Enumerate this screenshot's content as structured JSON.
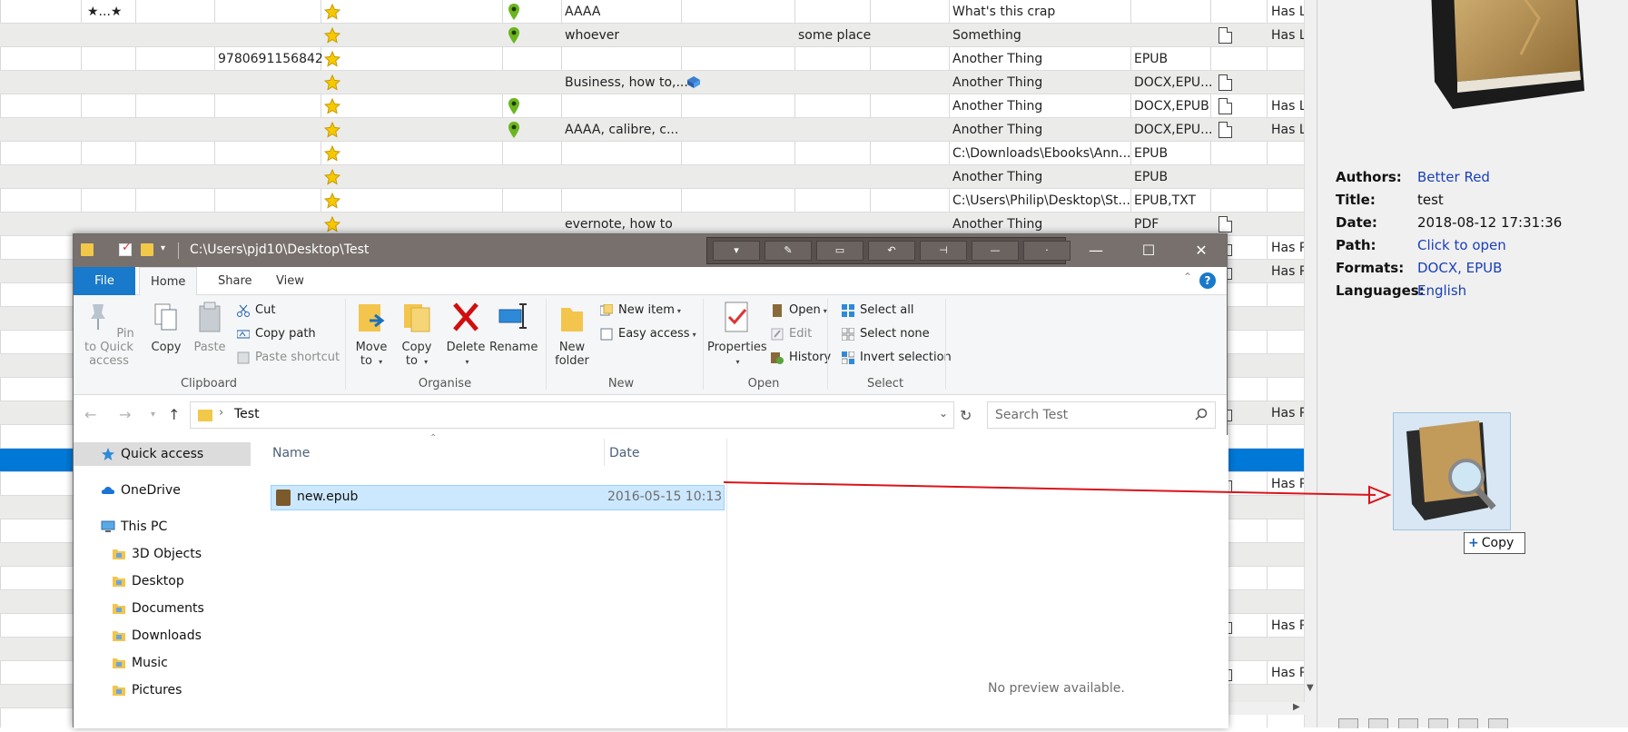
{
  "library": {
    "rows": [
      {
        "rating_text": "★...★",
        "isbn": "",
        "pin": true,
        "tags": "AAAA",
        "book_icon": false,
        "location": "",
        "publisher": "What's this crap",
        "formats": "",
        "doc": false,
        "note": "Has Le"
      },
      {
        "rating_text": "",
        "isbn": "",
        "pin": true,
        "tags": "whoever",
        "book_icon": false,
        "location": "some place",
        "publisher": "Something",
        "formats": "",
        "doc": true,
        "note": "Has Le"
      },
      {
        "rating_text": "",
        "isbn": "9780691156842",
        "pin": false,
        "tags": "",
        "book_icon": false,
        "location": "",
        "publisher": "Another Thing",
        "formats": "EPUB",
        "doc": false,
        "note": ""
      },
      {
        "rating_text": "",
        "isbn": "",
        "pin": false,
        "tags": "Business, how to,...",
        "book_icon": true,
        "location": "",
        "publisher": "Another Thing",
        "formats": "DOCX,EPU...",
        "doc": true,
        "note": ""
      },
      {
        "rating_text": "",
        "isbn": "",
        "pin": true,
        "tags": "",
        "book_icon": false,
        "location": "",
        "publisher": "Another Thing",
        "formats": "DOCX,EPUB",
        "doc": true,
        "note": "Has Le"
      },
      {
        "rating_text": "",
        "isbn": "",
        "pin": true,
        "tags": "AAAA, calibre, c...",
        "book_icon": false,
        "location": "",
        "publisher": "Another Thing",
        "formats": "DOCX,EPU...",
        "doc": true,
        "note": "Has Le"
      },
      {
        "rating_text": "",
        "isbn": "",
        "pin": false,
        "tags": "",
        "book_icon": false,
        "location": "",
        "publisher": "C:\\Downloads\\Ebooks\\Ann...",
        "formats": "EPUB",
        "doc": false,
        "note": ""
      },
      {
        "rating_text": "",
        "isbn": "",
        "pin": false,
        "tags": "",
        "book_icon": false,
        "location": "",
        "publisher": "Another Thing",
        "formats": "EPUB",
        "doc": false,
        "note": ""
      },
      {
        "rating_text": "",
        "isbn": "",
        "pin": false,
        "tags": "",
        "book_icon": false,
        "location": "",
        "publisher": "C:\\Users\\Philip\\Desktop\\St...",
        "formats": "EPUB,TXT",
        "doc": false,
        "note": ""
      },
      {
        "rating_text": "",
        "isbn": "",
        "pin": false,
        "tags": "evernote, how to",
        "book_icon": false,
        "location": "",
        "publisher": "Another Thing",
        "formats": "PDF",
        "doc": true,
        "note": ""
      }
    ],
    "right_notes": [
      {
        "row": 10,
        "note": "Has P"
      },
      {
        "row": 11,
        "note": "Has P"
      },
      {
        "row": 17,
        "note": "Has P"
      },
      {
        "row": 20,
        "note": "Has P"
      },
      {
        "row": 26,
        "note": "Has P"
      },
      {
        "row": 28,
        "note": "Has P"
      }
    ],
    "selected_row": 19
  },
  "details": {
    "fields": [
      {
        "label": "Authors:",
        "value": "Better Red",
        "link": true
      },
      {
        "label": "Title:",
        "value": "test",
        "link": false
      },
      {
        "label": "Date:",
        "value": "2018-08-12 17:31:36",
        "link": false
      },
      {
        "label": "Path:",
        "value": "Click to open",
        "link": true
      },
      {
        "label": "Formats:",
        "value": "DOCX, EPUB",
        "link": true
      },
      {
        "label": "Languages:",
        "value": "English",
        "link": true
      }
    ],
    "copy_badge": {
      "plus": "+",
      "label": "Copy"
    }
  },
  "explorer": {
    "title": "C:\\Users\\pjd10\\Desktop\\Test",
    "window_buttons": {
      "minimize": "—",
      "maximize": "☐",
      "close": "✕"
    },
    "tabs": [
      {
        "label": "File"
      },
      {
        "label": "Home"
      },
      {
        "label": "Share"
      },
      {
        "label": "View"
      }
    ],
    "help": "?",
    "ribbon": {
      "clipboard": {
        "group_label": "Clipboard",
        "pin": "Pin to Quick access",
        "copy": "Copy",
        "paste": "Paste",
        "cut": "Cut",
        "copy_path": "Copy path",
        "paste_shortcut": "Paste shortcut"
      },
      "organise": {
        "group_label": "Organise",
        "move_to": "Move to",
        "copy_to": "Copy to",
        "delete": "Delete",
        "rename": "Rename"
      },
      "new": {
        "group_label": "New",
        "new_folder": "New folder",
        "new_item": "New item",
        "easy_access": "Easy access"
      },
      "open": {
        "group_label": "Open",
        "properties": "Properties",
        "open": "Open",
        "edit": "Edit",
        "history": "History"
      },
      "select": {
        "group_label": "Select",
        "select_all": "Select all",
        "select_none": "Select none",
        "invert_selection": "Invert selection"
      }
    },
    "address": {
      "path": "Test"
    },
    "search": {
      "placeholder": "Search Test"
    },
    "nav": [
      {
        "label": "Quick access",
        "icon": "star-icon",
        "indent": 1,
        "highlight": true
      },
      {
        "label": "OneDrive",
        "icon": "cloud-icon",
        "indent": 1,
        "highlight": false
      },
      {
        "label": "This PC",
        "icon": "computer-icon",
        "indent": 1,
        "highlight": false
      },
      {
        "label": "3D Objects",
        "icon": "folder-3d-icon",
        "indent": 2,
        "highlight": false
      },
      {
        "label": "Desktop",
        "icon": "folder-desktop-icon",
        "indent": 2,
        "highlight": false
      },
      {
        "label": "Documents",
        "icon": "folder-documents-icon",
        "indent": 2,
        "highlight": false
      },
      {
        "label": "Downloads",
        "icon": "folder-downloads-icon",
        "indent": 2,
        "highlight": false
      },
      {
        "label": "Music",
        "icon": "folder-music-icon",
        "indent": 2,
        "highlight": false
      },
      {
        "label": "Pictures",
        "icon": "folder-pictures-icon",
        "indent": 2,
        "highlight": false
      }
    ],
    "columns": {
      "name": "Name",
      "date": "Date"
    },
    "files": [
      {
        "name": "new.epub",
        "date": "2016-05-15 10:13",
        "icon": "epub-file-icon"
      }
    ],
    "preview_text": "No preview available."
  },
  "colors": {
    "accent": "#0078d7",
    "link": "#1a3fb8",
    "drag_arrow": "#d9141b",
    "titlebar": "#78706c"
  }
}
